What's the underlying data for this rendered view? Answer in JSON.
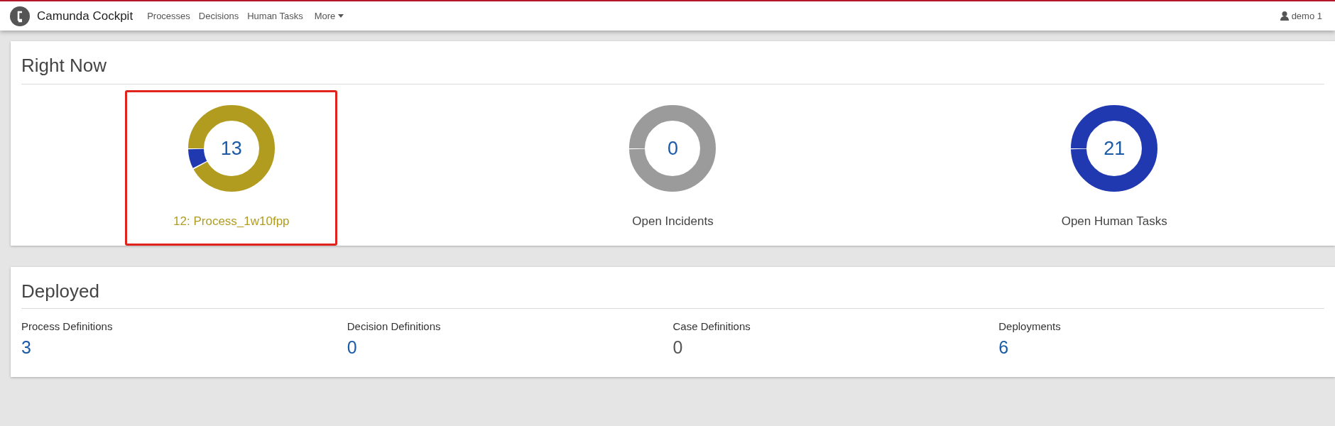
{
  "navbar": {
    "brand": "Camunda Cockpit",
    "links": [
      {
        "label": "Processes",
        "kind": "link"
      },
      {
        "label": "Decisions",
        "kind": "link"
      },
      {
        "label": "Human Tasks",
        "kind": "link"
      },
      {
        "label": "More",
        "kind": "dropdown"
      }
    ],
    "user": "demo 1"
  },
  "right_now": {
    "title": "Right Now",
    "items": [
      {
        "count": "13",
        "label": "12: Process_1w10fpp",
        "highlighted": true,
        "segments": [
          {
            "color": "#b19c20",
            "level": 0.923
          },
          {
            "color": "#2038b0",
            "level": 0.077
          }
        ]
      },
      {
        "count": "0",
        "label": "Open Incidents",
        "highlighted": false,
        "segments": [
          {
            "color": "#9b9b9b",
            "level": 1
          }
        ]
      },
      {
        "count": "21",
        "label": "Open Human Tasks",
        "highlighted": false,
        "segments": [
          {
            "color": "#2038b0",
            "level": 1
          }
        ]
      }
    ]
  },
  "deployed": {
    "title": "Deployed",
    "items": [
      {
        "label": "Process Definitions",
        "value": "3",
        "link": true
      },
      {
        "label": "Decision Definitions",
        "value": "0",
        "link": true
      },
      {
        "label": "Case Definitions",
        "value": "0",
        "link": false
      },
      {
        "label": "Deployments",
        "value": "6",
        "link": true
      }
    ]
  }
}
